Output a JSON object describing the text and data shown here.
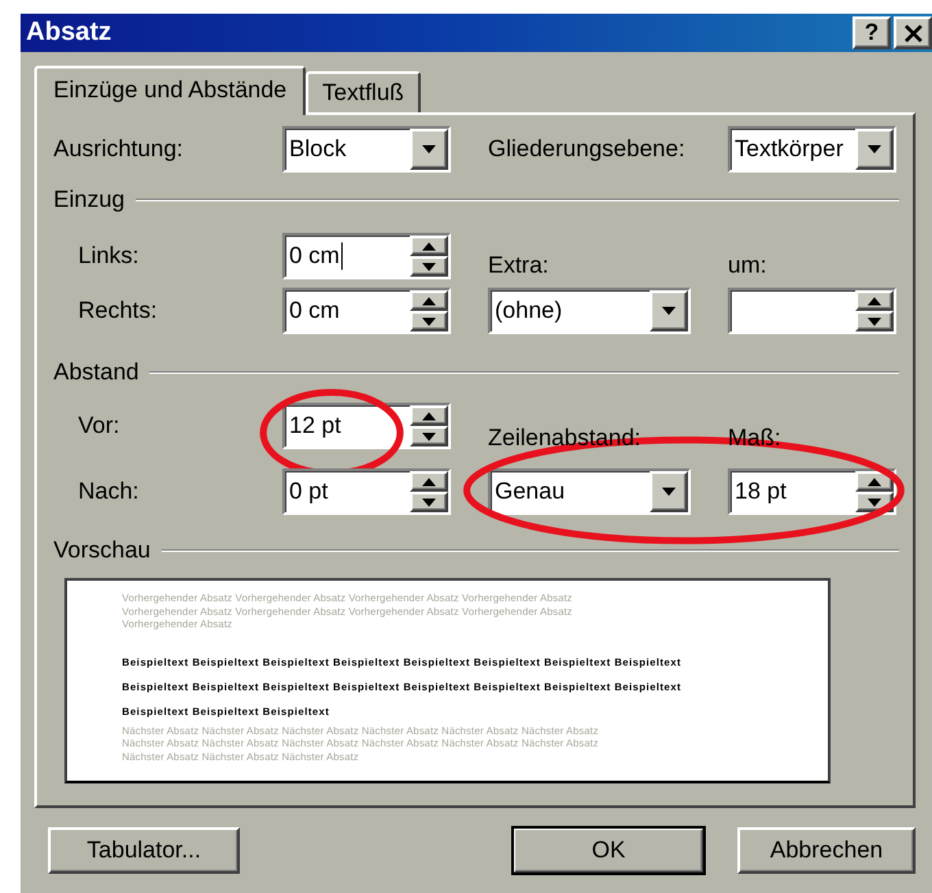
{
  "window": {
    "title": "Absatz",
    "title_buttons": [
      {
        "kind": "help",
        "label": "?"
      },
      {
        "kind": "close"
      }
    ]
  },
  "tabs": [
    {
      "label": "Einzüge und Abstände",
      "selected": true
    },
    {
      "label": "Textfluß",
      "selected": false
    }
  ],
  "alignment": {
    "label": "Ausrichtung:",
    "value": "Block"
  },
  "outline_level": {
    "label": "Gliederungsebene:",
    "value": "Textkörper"
  },
  "indent": {
    "title": "Einzug",
    "left": {
      "label": "Links:",
      "value": "0 cm",
      "focused": true
    },
    "right": {
      "label": "Rechts:",
      "value": "0 cm",
      "focused": false
    },
    "special": {
      "label": "Extra:",
      "value": "(ohne)"
    },
    "by": {
      "label": "um:",
      "focused": false
    }
  },
  "spacing": {
    "title": "Abstand",
    "before": {
      "label": "Vor:",
      "value": "12 pt",
      "highlighted": true
    },
    "after": {
      "label": "Nach:",
      "value": "0 pt"
    },
    "line_spacing": {
      "label": "Zeilenabstand:",
      "value": "Genau",
      "highlighted": true
    },
    "at": {
      "label": "Maß:",
      "value": "18 pt"
    }
  },
  "preview": {
    "title": "Vorschau",
    "paragraphs": [
      {
        "kind": "previous",
        "lines": [
          "Vorhergehender Absatz Vorhergehender Absatz Vorhergehender Absatz Vorhergehender Absatz",
          "Vorhergehender Absatz Vorhergehender Absatz Vorhergehender Absatz Vorhergehender Absatz",
          "Vorhergehender Absatz"
        ]
      },
      {
        "kind": "sample",
        "lines": [
          "Beispieltext Beispieltext Beispieltext Beispieltext Beispieltext Beispieltext Beispieltext Beispieltext",
          "Beispieltext Beispieltext Beispieltext Beispieltext Beispieltext Beispieltext Beispieltext Beispieltext",
          "Beispieltext Beispieltext Beispieltext"
        ]
      },
      {
        "kind": "next",
        "lines": [
          "Nächster Absatz Nächster Absatz Nächster Absatz Nächster Absatz Nächster Absatz Nächster Absatz",
          "Nächster Absatz Nächster Absatz Nächster Absatz Nächster Absatz Nächster Absatz Nächster Absatz",
          "Nächster Absatz Nächster Absatz Nächster Absatz"
        ]
      }
    ]
  },
  "buttons": [
    {
      "label": "Tabulator...",
      "default": false
    },
    {
      "label": "OK",
      "default": true
    },
    {
      "label": "Abbrechen",
      "default": false
    }
  ]
}
